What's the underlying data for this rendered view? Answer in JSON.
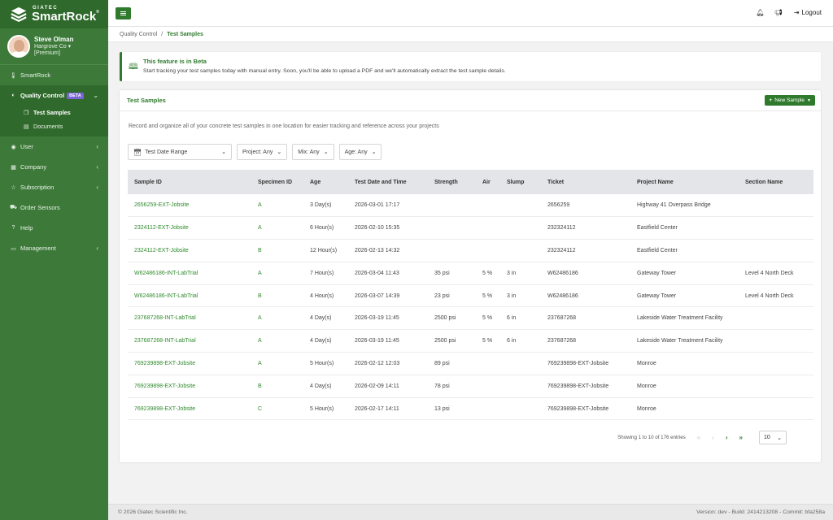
{
  "brand": {
    "company": "GIATEC",
    "product": "SmartRock",
    "mark": "®"
  },
  "user": {
    "name": "Steve Olman",
    "org": "Hargrove Co ▾",
    "plan": "[Premium]"
  },
  "sidebar": {
    "items": [
      {
        "label": "SmartRock",
        "icon": "thermometer-icon"
      },
      {
        "label": "Quality Control",
        "icon": "shield-icon",
        "badge": "BETA"
      },
      {
        "label": "User",
        "icon": "user-icon"
      },
      {
        "label": "Company",
        "icon": "building-icon"
      },
      {
        "label": "Subscription",
        "icon": "star-icon"
      },
      {
        "label": "Order Sensors",
        "icon": "cart-icon"
      },
      {
        "label": "Help",
        "icon": "help-icon"
      },
      {
        "label": "Management",
        "icon": "card-icon"
      }
    ],
    "sub_items": [
      {
        "label": "Test Samples"
      },
      {
        "label": "Documents"
      }
    ]
  },
  "topbar": {
    "logout_label": "Logout"
  },
  "breadcrumb": {
    "parent": "Quality Control",
    "sep": "/",
    "current": "Test Samples"
  },
  "alert": {
    "title": "This feature is in Beta",
    "text": "Start tracking your test samples today with manual entry. Soon, you'll be able to upload a PDF and we'll automatically extract the test sample details."
  },
  "card": {
    "title": "Test Samples",
    "new_button": "New Sample",
    "description": "Record and organize all of your concrete test samples in one location for easier tracking and reference across your projects"
  },
  "filters": {
    "date_range": "Test Date Range",
    "project": "Project: Any",
    "mix": "Mix: Any",
    "age": "Age: Any"
  },
  "table": {
    "columns": [
      "Sample ID",
      "Specimen ID",
      "Age",
      "Test Date and Time",
      "Strength",
      "Air",
      "Slump",
      "Ticket",
      "Project Name",
      "Section Name"
    ],
    "rows": [
      [
        "2656259-EXT-Jobsite",
        "A",
        "3 Day(s)",
        "2026-03-01 17:17",
        "",
        "",
        "",
        "2656259",
        "Highway 41 Overpass Bridge",
        ""
      ],
      [
        "2324112-EXT-Jobsite",
        "A",
        "6 Hour(s)",
        "2026-02-10 15:35",
        "",
        "",
        "",
        "232324112",
        "Eastfield Center",
        ""
      ],
      [
        "2324112-EXT-Jobsite",
        "B",
        "12 Hour(s)",
        "2026-02-13 14:32",
        "",
        "",
        "",
        "232324112",
        "Eastfield Center",
        ""
      ],
      [
        "W62486186-INT-LabTrial",
        "A",
        "7 Hour(s)",
        "2026-03-04 11:43",
        "35 psi",
        "5 %",
        "3 in",
        "W62486186",
        "Gateway Tower",
        "Level 4 North Deck"
      ],
      [
        "W62486186-INT-LabTrial",
        "B",
        "4 Hour(s)",
        "2026-03-07 14:39",
        "23 psi",
        "5 %",
        "3 in",
        "W62486186",
        "Gateway Tower",
        "Level 4 North Deck"
      ],
      [
        "237687268-INT-LabTrial",
        "A",
        "4 Day(s)",
        "2026-03-19 11:45",
        "2500 psi",
        "5 %",
        "6 in",
        "237687268",
        "Lakeside Water Treatment Facility",
        ""
      ],
      [
        "237687268-INT-LabTrial",
        "A",
        "4 Day(s)",
        "2026-03-19 11:45",
        "2500 psi",
        "5 %",
        "6 in",
        "237687268",
        "Lakeside Water Treatment Facility",
        ""
      ],
      [
        "769239898-EXT-Jobsite",
        "A",
        "5 Hour(s)",
        "2026-02-12 12:03",
        "89 psi",
        "",
        "",
        "769239898-EXT-Jobsite",
        "Monroe",
        ""
      ],
      [
        "769239898-EXT-Jobsite",
        "B",
        "4 Day(s)",
        "2026-02-09 14:11",
        "78 psi",
        "",
        "",
        "769239898-EXT-Jobsite",
        "Monroe",
        ""
      ],
      [
        "769239898-EXT-Jobsite",
        "C",
        "5 Hour(s)",
        "2026-02-17 14:11",
        "13 psi",
        "",
        "",
        "769239898-EXT-Jobsite",
        "Monroe",
        ""
      ]
    ]
  },
  "pagination": {
    "summary": "Showing 1 to 10 of 176 entries",
    "page_size": "10"
  },
  "footer": {
    "copyright": "© 2026 Giatec Scientific Inc.",
    "version": "Version: dev - Build: 2414213208 - Commit: bfa258a"
  },
  "colors": {
    "sidebar": "#3d7a3a",
    "sidebar_dark": "#2f6a2c",
    "accent": "#2f7a2c",
    "beta_badge": "#7b63d8"
  }
}
